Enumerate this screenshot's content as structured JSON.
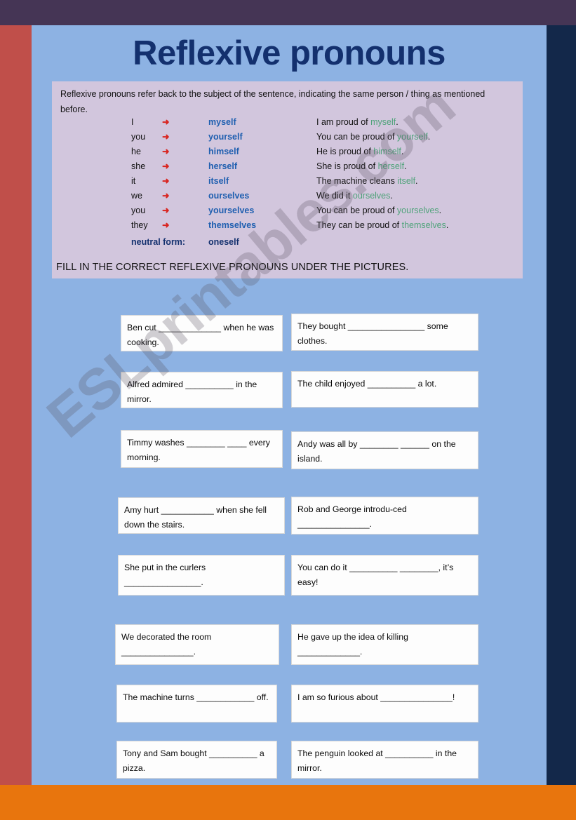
{
  "page": {
    "title": "Reflexive pronouns",
    "watermark": "ESLprintables.com",
    "colors": {
      "top_bar": "#453555",
      "left_bar": "#c04f4a",
      "right_bar": "#13284a",
      "bottom_bar": "#e8750d",
      "sheet": "#8db2e3",
      "panel": "#d2c6dd",
      "title": "#13306e",
      "reflexive": "#1f5fb0",
      "arrow": "#d9241f",
      "example_highlight": "#4fa37a"
    }
  },
  "panel": {
    "intro": "Reflexive pronouns refer back to the subject of the sentence, indicating the same person / thing as mentioned before.",
    "arrow_glyph": "➜",
    "rows": [
      {
        "subject": "I",
        "reflexive": "myself",
        "example_pre": "I am proud of ",
        "example_word": "myself",
        "example_post": "."
      },
      {
        "subject": "you",
        "reflexive": "yourself",
        "example_pre": "You can be proud of ",
        "example_word": "yourself",
        "example_post": "."
      },
      {
        "subject": "he",
        "reflexive": "himself",
        "example_pre": "He is proud of ",
        "example_word": "himself",
        "example_post": "."
      },
      {
        "subject": "she",
        "reflexive": "herself",
        "example_pre": "She is proud of ",
        "example_word": "herself",
        "example_post": "."
      },
      {
        "subject": "it",
        "reflexive": "itself",
        "example_pre": "The machine cleans ",
        "example_word": "itself",
        "example_post": "."
      },
      {
        "subject": "we",
        "reflexive": "ourselves",
        "example_pre": "We did it ",
        "example_word": "ourselves",
        "example_post": "."
      },
      {
        "subject": "you",
        "reflexive": "yourselves",
        "example_pre": "You can be proud of ",
        "example_word": "yourselves",
        "example_post": "."
      },
      {
        "subject": "they",
        "reflexive": "themselves",
        "example_pre": "They can be proud of ",
        "example_word": "themselves",
        "example_post": "."
      }
    ],
    "neutral_label": "neutral form:",
    "neutral_word": "oneself",
    "instruction": "FILL IN THE CORRECT REFLEXIVE PRONOUNS UNDER THE PICTURES."
  },
  "exercises": [
    {
      "id": 1,
      "text": "Ben cut _____________ when he was cooking."
    },
    {
      "id": 2,
      "text": "They bought ________________ some clothes."
    },
    {
      "id": 3,
      "text": "Alfred admired __________ in the mirror."
    },
    {
      "id": 4,
      "text": "The child enjoyed __________ a lot."
    },
    {
      "id": 5,
      "text": "Timmy washes ________ ____ every morning."
    },
    {
      "id": 6,
      "text": "Andy was all by ________ ______ on the island."
    },
    {
      "id": 7,
      "text": "Amy hurt ___________ when she fell down the stairs."
    },
    {
      "id": 8,
      "text": "Rob and George introdu-ced _______________."
    },
    {
      "id": 9,
      "text": "She put in the curlers ________________."
    },
    {
      "id": 10,
      "text": "You can do it __________ ________, it’s easy!"
    },
    {
      "id": 11,
      "text": "We decorated the room _______________."
    },
    {
      "id": 12,
      "text": "He gave up the idea of killing _____________."
    },
    {
      "id": 13,
      "text": "The machine turns ____________ off."
    },
    {
      "id": 14,
      "text": "I am so furious about _______________!"
    },
    {
      "id": 15,
      "text": "Tony and Sam bought __________ a pizza."
    },
    {
      "id": 16,
      "text": "The penguin looked at __________ in the mirror."
    }
  ]
}
